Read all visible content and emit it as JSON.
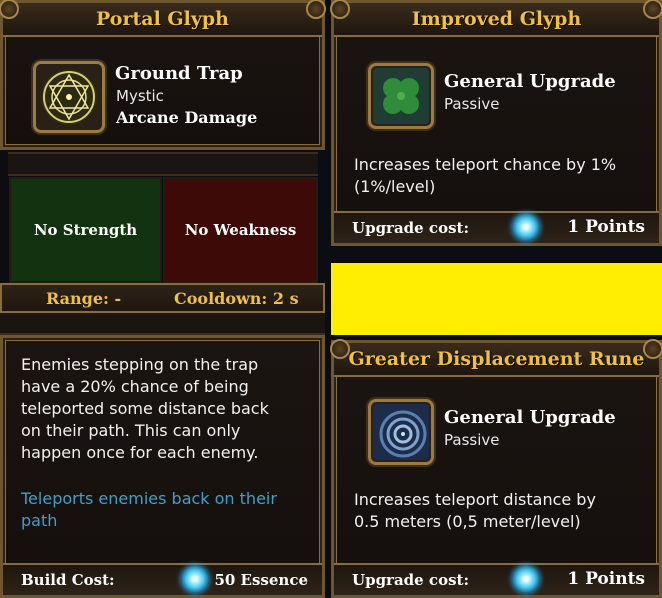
{
  "left_panel": {
    "title": "Portal Glyph",
    "ability_name": "Ground Trap",
    "ability_type": "Mystic",
    "damage_type": "Arcane Damage",
    "strength_label": "No Strength",
    "weakness_label": "No Weakness",
    "range": "Range: -",
    "cooldown": "Cooldown: 2 s",
    "description_lines": [
      "Enemies stepping on the trap",
      "have a 20% chance of being",
      "teleported some distance back",
      "on their path. This can only",
      "happen once for each enemy."
    ],
    "highlight_lines": [
      "Teleports enemies back on their",
      "path"
    ],
    "build_cost_label": "Build Cost:",
    "build_cost_value": "50 Essence",
    "colors": {
      "strength_bg": "#12330f",
      "weakness_bg": "#3e0a08",
      "highlight_text": "#3fa0c8"
    }
  },
  "upgrade_1": {
    "title": "Improved Glyph",
    "name": "General Upgrade",
    "type": "Passive",
    "description_lines": [
      "Increases teleport chance by 1%",
      "(1%/level)"
    ],
    "cost_label": "Upgrade cost:",
    "cost_value": "1 Points",
    "icon": "clover-icon"
  },
  "upgrade_2": {
    "title": "Greater Displacement Rune",
    "name": "General Upgrade",
    "type": "Passive",
    "description_lines": [
      "Increases teleport distance by",
      "0.5 meters (0,5 meter/level)"
    ],
    "cost_label": "Upgrade cost:",
    "cost_value": "1 Points",
    "icon": "spiral-rune-icon"
  },
  "colors": {
    "title_gold": "#f0c040",
    "frame": "#8a6d3c",
    "highlight_block": "#ffee00"
  }
}
